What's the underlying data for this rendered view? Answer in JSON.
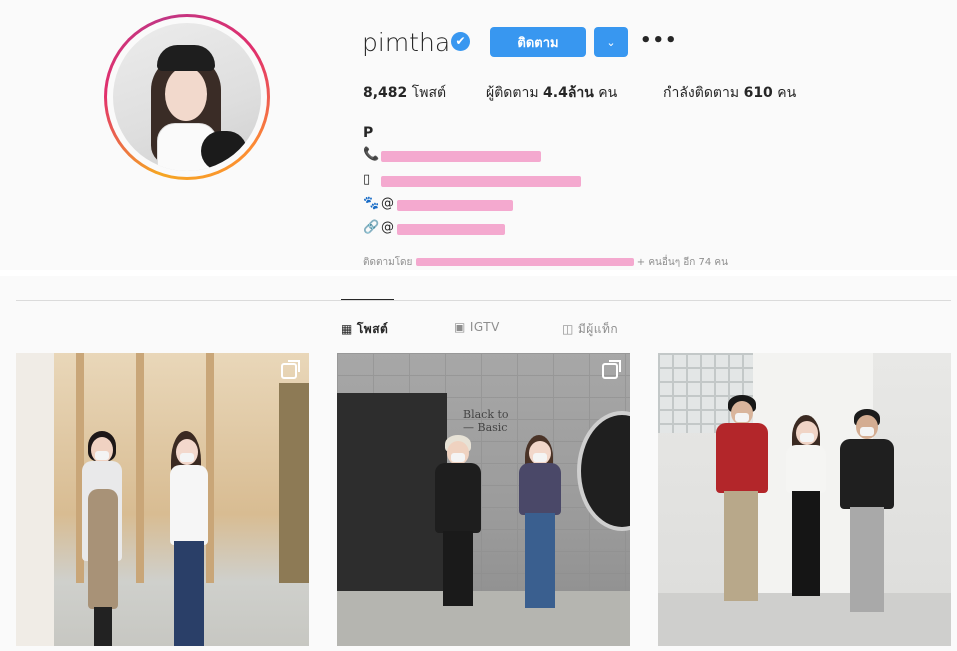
{
  "profile": {
    "username": "pimtha",
    "verified_icon": "✔",
    "follow_label": "ติดตาม",
    "dropdown_icon": "⌄",
    "more_icon": "•••"
  },
  "stats": {
    "posts_count": "8,482",
    "posts_label": "โพสต์",
    "followers_prefix": "ผู้ติดตาม",
    "followers_count": "4.4ล้าน",
    "followers_suffix": "คน",
    "following_prefix": "กำลังติดตาม",
    "following_count": "610",
    "following_suffix": "คน"
  },
  "bio": {
    "name": "P",
    "lines": [
      {
        "icon": "📞",
        "text": ""
      },
      {
        "icon": "▯",
        "text": ""
      },
      {
        "icon": "🐾",
        "text": "@"
      },
      {
        "icon": "🔗",
        "text": "@"
      }
    ],
    "followed_by_prefix": "ติดตามโดย",
    "followed_by_suffix": "+ คนอื่นๆ อีก 74 คน"
  },
  "tabs": [
    {
      "label": "โพสต์",
      "icon": "▦",
      "active": true
    },
    {
      "label": "IGTV",
      "icon": "▣",
      "active": false
    },
    {
      "label": "มีผู้แท็ก",
      "icon": "◫",
      "active": false
    }
  ],
  "posts": [
    {
      "multi": true
    },
    {
      "multi": true,
      "sign_text": "Black to\n— Basic"
    },
    {
      "multi": false
    }
  ],
  "colors": {
    "accent": "#3897f0",
    "redaction": "#f4a9cf",
    "muted": "#8e8e8e"
  }
}
